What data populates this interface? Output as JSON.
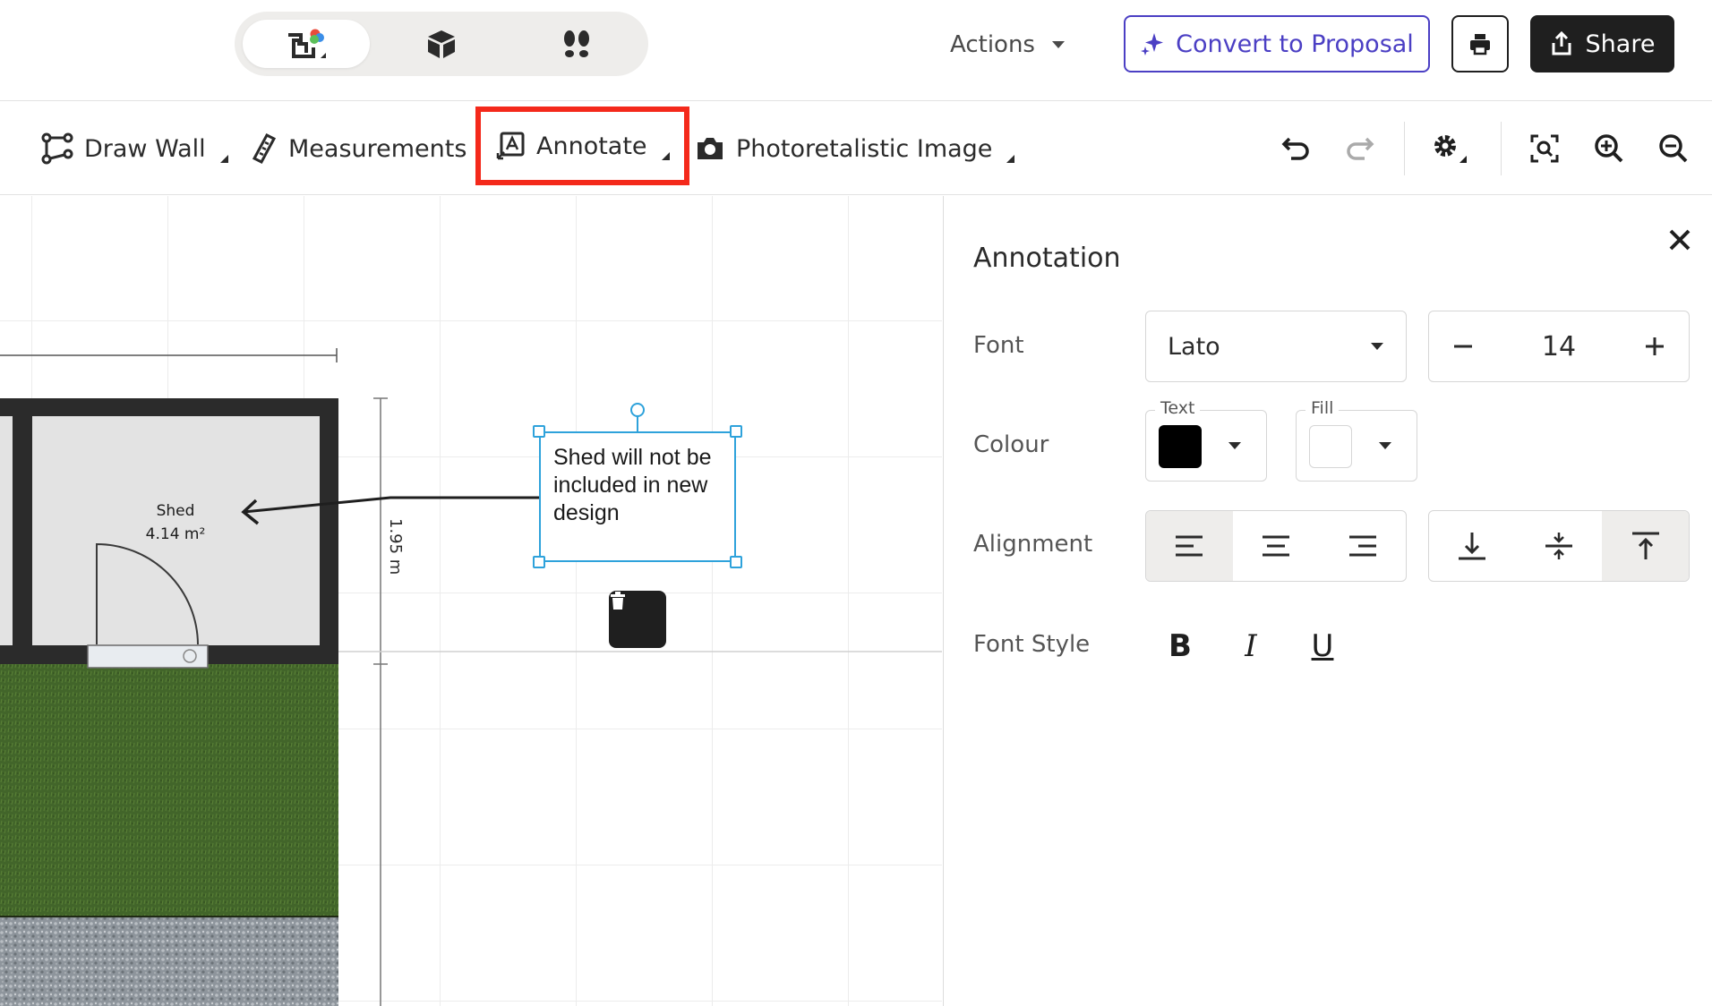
{
  "app": {
    "view_modes": [
      {
        "name": "2d-plan-icon",
        "active": true
      },
      {
        "name": "3d-box-icon",
        "active": false
      },
      {
        "name": "walkthrough-footsteps-icon",
        "active": false
      }
    ],
    "actions_label": "Actions",
    "convert_label": "Convert to Proposal",
    "share_label": "Share",
    "accent_color": "#4b3fc4"
  },
  "toolbar": {
    "draw_wall_label": "Draw Wall",
    "measurements_label": "Measurements",
    "annotate_label": "Annotate",
    "photo_label": "Photoretalistic Image",
    "highlight_color": "#f4291b"
  },
  "canvas": {
    "room_name": "Shed",
    "room_area": "4.14 m²",
    "dimension": "1.95 m",
    "annotation_text": "Shed will not be included in new design",
    "selection_color": "#2ea2db"
  },
  "panel": {
    "title": "Annotation",
    "font_label": "Font",
    "font_value": "Lato",
    "size_value": "14",
    "colour_label": "Colour",
    "text_caption": "Text",
    "fill_caption": "Fill",
    "text_color": "#000000",
    "fill_color": "#ffffff",
    "alignment_label": "Alignment",
    "horizontal_alignment": "left",
    "vertical_alignment": "top",
    "font_style_label": "Font Style",
    "bold_glyph": "B",
    "italic_glyph": "I",
    "underline_glyph": "U"
  }
}
